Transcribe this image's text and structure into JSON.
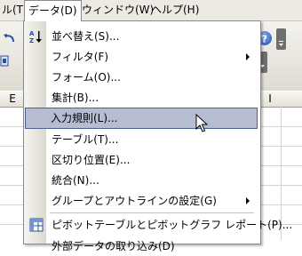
{
  "menubar": {
    "items": [
      {
        "label": "ル(T)"
      },
      {
        "label": "データ(D)"
      },
      {
        "label": "ウィンドウ(W)"
      },
      {
        "label": "ヘルプ(H)"
      }
    ]
  },
  "sheet": {
    "columns": [
      "E",
      "I"
    ]
  },
  "menu": {
    "items": [
      {
        "label": "並べ替え(S)...",
        "icon": "sort-az-icon"
      },
      {
        "label": "フィルタ(F)",
        "submenu": true
      },
      {
        "label": "フォーム(O)..."
      },
      {
        "label": "集計(B)..."
      },
      {
        "label": "入力規則(L)...",
        "highlighted": true
      },
      {
        "label": "テーブル(T)..."
      },
      {
        "label": "区切り位置(E)..."
      },
      {
        "label": "統合(N)..."
      },
      {
        "label": "グループとアウトラインの設定(G)",
        "submenu": true
      },
      {
        "label": "ピボットテーブルとピボットグラフ レポート(P)...",
        "icon": "pivot-table-icon"
      },
      {
        "label": "外部データの取り込み(D)"
      }
    ]
  },
  "colors": {
    "highlight_fill": "#b6bdd2",
    "highlight_border": "#4b5f91",
    "menubar_bg": "#eceae2"
  }
}
